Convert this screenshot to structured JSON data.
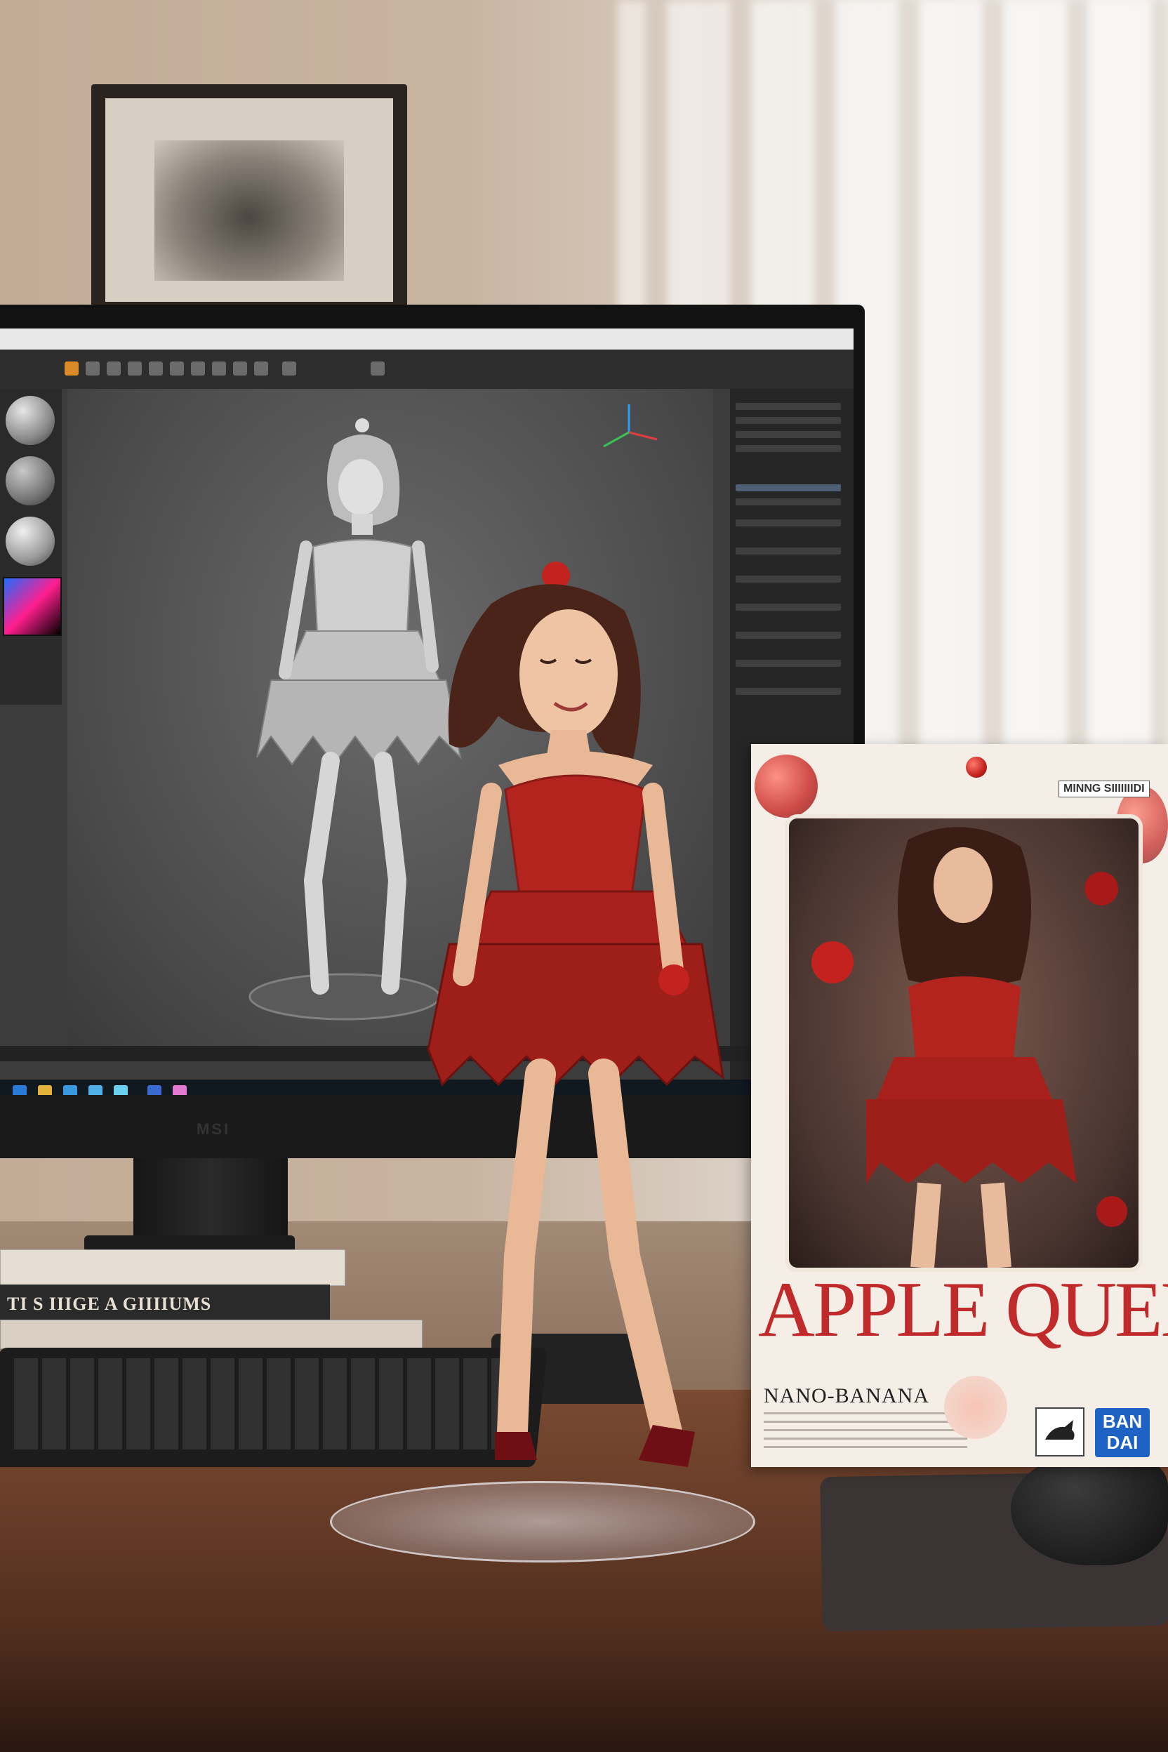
{
  "scene": {
    "description_colors": {
      "wall": "#c5af9b",
      "desk": "#6a3e29",
      "dress_red": "#b3241f",
      "box_title_red": "#c12a2a",
      "bandai_blue": "#1e63c4"
    }
  },
  "monitor": {
    "brand": "MSI",
    "app_icons": [
      "sphere-material-icon",
      "color-picker-icon",
      "gizmo-icon"
    ]
  },
  "books": {
    "spine_title": "TI S IIIGE A GIIIIUMS"
  },
  "product_box": {
    "brand_tag": "MINNG SIIIIIIIDI",
    "title": "APPLE QUEEN",
    "subtitle": "NANO-BANANA",
    "maker_logo": "BAN\nDAI"
  }
}
